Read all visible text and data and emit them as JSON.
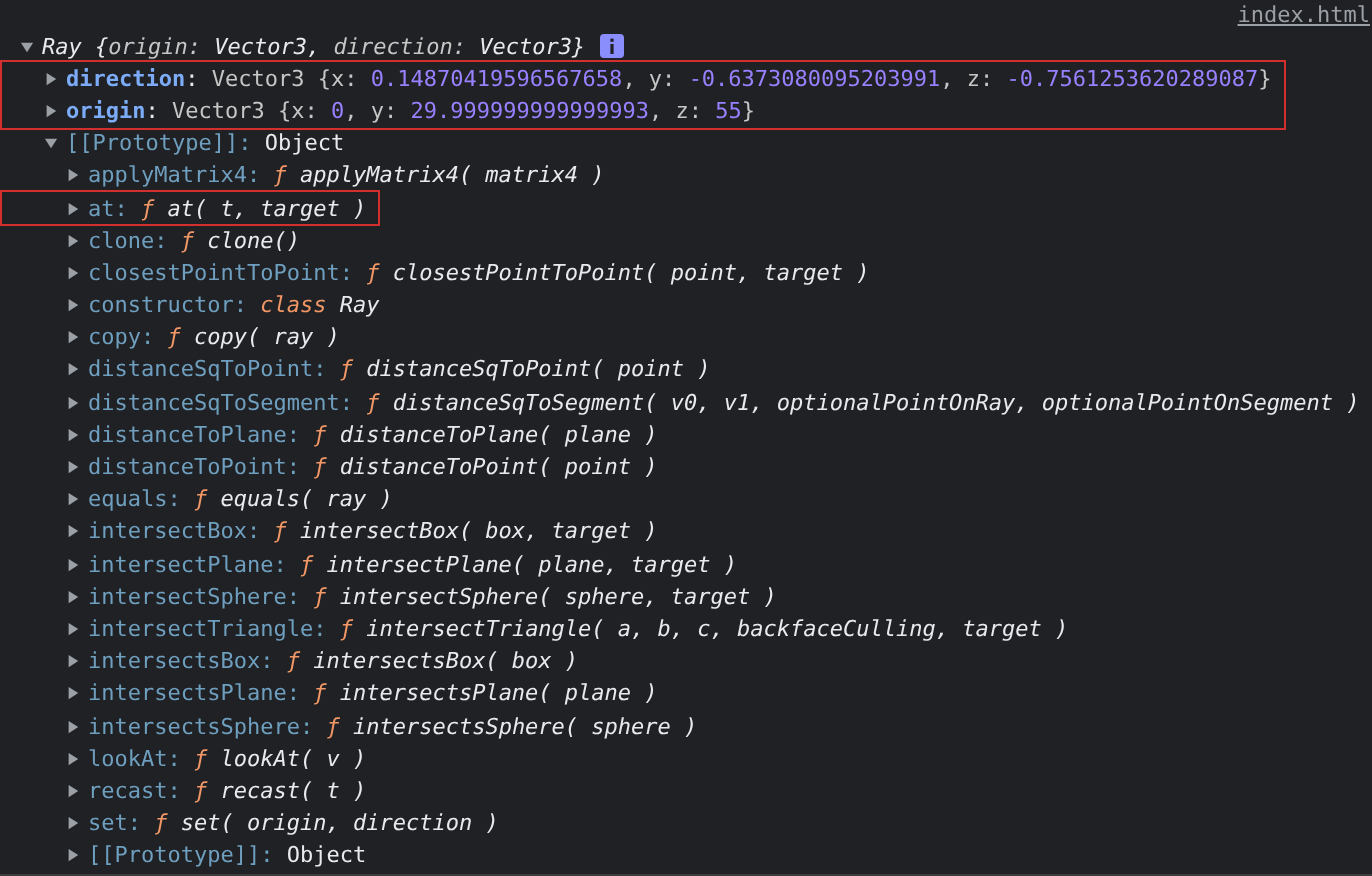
{
  "source_link": "index.html",
  "object": {
    "name": "Ray",
    "expanded": true,
    "summary": [
      {
        "kind": "plain",
        "text": "{"
      },
      {
        "kind": "key",
        "text": "origin: "
      },
      {
        "kind": "plain",
        "text": "Vector3, "
      },
      {
        "kind": "key",
        "text": "direction: "
      },
      {
        "kind": "plain",
        "text": "Vector3}"
      }
    ],
    "properties": [
      {
        "key": "direction",
        "expanded": false,
        "highlighted": true,
        "parts": [
          {
            "kind": "plain",
            "text": ": "
          },
          {
            "kind": "type",
            "text": "Vector3 {x: "
          },
          {
            "kind": "number",
            "text": "0.14870419596567658"
          },
          {
            "kind": "type",
            "text": ", y: "
          },
          {
            "kind": "number",
            "text": "-0.6373080095203991"
          },
          {
            "kind": "type",
            "text": ", z: "
          },
          {
            "kind": "number",
            "text": "-0.7561253620289087"
          },
          {
            "kind": "type",
            "text": "}"
          }
        ]
      },
      {
        "key": "origin",
        "expanded": false,
        "highlighted": true,
        "parts": [
          {
            "kind": "plain",
            "text": ": "
          },
          {
            "kind": "type",
            "text": "Vector3 {x: "
          },
          {
            "kind": "number",
            "text": "0"
          },
          {
            "kind": "type",
            "text": ", y: "
          },
          {
            "kind": "number",
            "text": "29.999999999999993"
          },
          {
            "kind": "type",
            "text": ", z: "
          },
          {
            "kind": "number",
            "text": "55"
          },
          {
            "kind": "type",
            "text": "}"
          }
        ]
      }
    ],
    "prototype": {
      "key": "[[Prototype]]:",
      "value": "Object",
      "expanded": true,
      "members": [
        {
          "key": "applyMatrix4:",
          "kind": "function",
          "marker": "ƒ",
          "value": "applyMatrix4( matrix4 )",
          "expanded": false,
          "highlighted": false
        },
        {
          "key": "at:",
          "kind": "function",
          "marker": "ƒ",
          "value": "at( t, target )",
          "expanded": false,
          "highlighted": true
        },
        {
          "key": "clone:",
          "kind": "function",
          "marker": "ƒ",
          "value": "clone()",
          "expanded": false,
          "highlighted": false
        },
        {
          "key": "closestPointToPoint:",
          "kind": "function",
          "marker": "ƒ",
          "value": "closestPointToPoint( point, target )",
          "expanded": false,
          "highlighted": false
        },
        {
          "key": "constructor:",
          "kind": "class",
          "marker": "class",
          "value": "Ray",
          "expanded": false,
          "highlighted": false
        },
        {
          "key": "copy:",
          "kind": "function",
          "marker": "ƒ",
          "value": "copy( ray )",
          "expanded": false,
          "highlighted": false
        },
        {
          "key": "distanceSqToPoint:",
          "kind": "function",
          "marker": "ƒ",
          "value": "distanceSqToPoint( point )",
          "expanded": false,
          "highlighted": false
        },
        {
          "key": "distanceSqToSegment:",
          "kind": "function",
          "marker": "ƒ",
          "value": "distanceSqToSegment( v0, v1, optionalPointOnRay, optionalPointOnSegment )",
          "expanded": false,
          "highlighted": false
        },
        {
          "key": "distanceToPlane:",
          "kind": "function",
          "marker": "ƒ",
          "value": "distanceToPlane( plane )",
          "expanded": false,
          "highlighted": false
        },
        {
          "key": "distanceToPoint:",
          "kind": "function",
          "marker": "ƒ",
          "value": "distanceToPoint( point )",
          "expanded": false,
          "highlighted": false
        },
        {
          "key": "equals:",
          "kind": "function",
          "marker": "ƒ",
          "value": "equals( ray )",
          "expanded": false,
          "highlighted": false
        },
        {
          "key": "intersectBox:",
          "kind": "function",
          "marker": "ƒ",
          "value": "intersectBox( box, target )",
          "expanded": false,
          "highlighted": false
        },
        {
          "key": "intersectPlane:",
          "kind": "function",
          "marker": "ƒ",
          "value": "intersectPlane( plane, target )",
          "expanded": false,
          "highlighted": false
        },
        {
          "key": "intersectSphere:",
          "kind": "function",
          "marker": "ƒ",
          "value": "intersectSphere( sphere, target )",
          "expanded": false,
          "highlighted": false
        },
        {
          "key": "intersectTriangle:",
          "kind": "function",
          "marker": "ƒ",
          "value": "intersectTriangle( a, b, c, backfaceCulling, target )",
          "expanded": false,
          "highlighted": false
        },
        {
          "key": "intersectsBox:",
          "kind": "function",
          "marker": "ƒ",
          "value": "intersectsBox( box )",
          "expanded": false,
          "highlighted": false
        },
        {
          "key": "intersectsPlane:",
          "kind": "function",
          "marker": "ƒ",
          "value": "intersectsPlane( plane )",
          "expanded": false,
          "highlighted": false
        },
        {
          "key": "intersectsSphere:",
          "kind": "function",
          "marker": "ƒ",
          "value": "intersectsSphere( sphere )",
          "expanded": false,
          "highlighted": false
        },
        {
          "key": "lookAt:",
          "kind": "function",
          "marker": "ƒ",
          "value": "lookAt( v )",
          "expanded": false,
          "highlighted": false
        },
        {
          "key": "recast:",
          "kind": "function",
          "marker": "ƒ",
          "value": "recast( t )",
          "expanded": false,
          "highlighted": false
        },
        {
          "key": "set:",
          "kind": "function",
          "marker": "ƒ",
          "value": "set( origin, direction )",
          "expanded": false,
          "highlighted": false
        },
        {
          "key": "[[Prototype]]:",
          "kind": "object",
          "value": "Object",
          "expanded": false,
          "highlighted": false
        }
      ]
    }
  }
}
